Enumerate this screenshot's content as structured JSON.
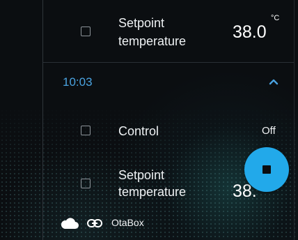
{
  "rows": [
    {
      "label_line1": "Setpoint",
      "label_line2": "temperature",
      "value": "38.0",
      "unit": "°C"
    },
    {
      "label_line1": "Control",
      "value": "Off"
    },
    {
      "label_line1": "Setpoint",
      "label_line2": "temperature",
      "value": "38."
    }
  ],
  "group": {
    "time": "10:03",
    "chevron_icon": "chevron-up-icon"
  },
  "fab": {
    "icon": "stop-icon",
    "color": "#22a9ea"
  },
  "footer": {
    "cloud_icon": "cloud-icon",
    "link_icon": "link-icon",
    "device_name": "OtaBox"
  },
  "colors": {
    "accent": "#4aa3e0",
    "background": "#0b0e11"
  }
}
